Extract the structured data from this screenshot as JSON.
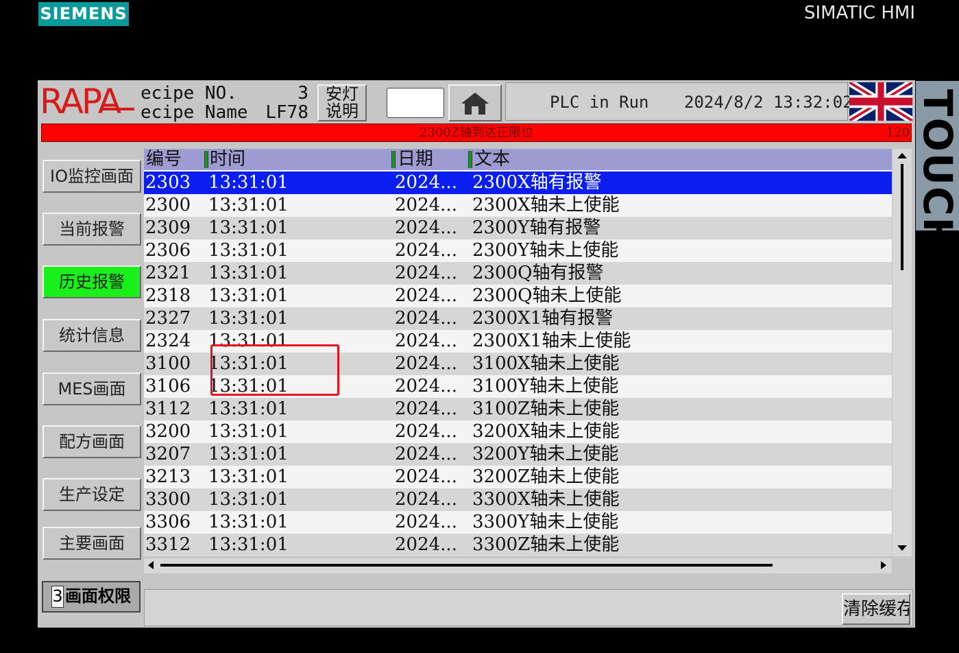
{
  "brand": {
    "logo_text": "SIEMENS",
    "product": "SIMATIC HMI",
    "side_label": "TOUCH"
  },
  "header": {
    "logo_text": "RAPA",
    "recipe_no_label": "ecipe NO.",
    "recipe_no_value": "3",
    "recipe_name_label": "ecipe Name",
    "recipe_name_value": "LF78",
    "andon_line1": "安灯",
    "andon_line2": "说明",
    "status_text": "PLC in Run",
    "datetime": "2024/8/2 13:32:02"
  },
  "alarm_bar": {
    "text": "2300Z轴到达正限位",
    "count": "120",
    "color": "#ff0000"
  },
  "sidebar": {
    "items": [
      {
        "label": "IO监控画面"
      },
      {
        "label": "当前报警"
      },
      {
        "label": "历史报警",
        "active": true
      },
      {
        "label": "统计信息"
      },
      {
        "label": "MES画面"
      },
      {
        "label": "配方画面"
      },
      {
        "label": "生产设定"
      },
      {
        "label": "主要画面"
      }
    ],
    "permission_level": "3",
    "permission_label": "画面权限"
  },
  "alarm_table": {
    "columns": [
      "编号",
      "时间",
      "日期",
      "文本"
    ],
    "rows": [
      {
        "no": "2303",
        "time": "13:31:01",
        "date": "2024...",
        "text": "2300X轴有报警",
        "selected": true
      },
      {
        "no": "2300",
        "time": "13:31:01",
        "date": "2024...",
        "text": "2300X轴未上使能"
      },
      {
        "no": "2309",
        "time": "13:31:01",
        "date": "2024...",
        "text": "2300Y轴有报警"
      },
      {
        "no": "2306",
        "time": "13:31:01",
        "date": "2024...",
        "text": "2300Y轴未上使能"
      },
      {
        "no": "2321",
        "time": "13:31:01",
        "date": "2024...",
        "text": "2300Q轴有报警"
      },
      {
        "no": "2318",
        "time": "13:31:01",
        "date": "2024...",
        "text": "2300Q轴未上使能"
      },
      {
        "no": "2327",
        "time": "13:31:01",
        "date": "2024...",
        "text": "2300X1轴有报警"
      },
      {
        "no": "2324",
        "time": "13:31:01",
        "date": "2024...",
        "text": "2300X1轴未上使能"
      },
      {
        "no": "3100",
        "time": "13:31:01",
        "date": "2024...",
        "text": "3100X轴未上使能"
      },
      {
        "no": "3106",
        "time": "13:31:01",
        "date": "2024...",
        "text": "3100Y轴未上使能"
      },
      {
        "no": "3112",
        "time": "13:31:01",
        "date": "2024...",
        "text": "3100Z轴未上使能"
      },
      {
        "no": "3200",
        "time": "13:31:01",
        "date": "2024...",
        "text": "3200X轴未上使能"
      },
      {
        "no": "3207",
        "time": "13:31:01",
        "date": "2024...",
        "text": "3200Y轴未上使能"
      },
      {
        "no": "3213",
        "time": "13:31:01",
        "date": "2024...",
        "text": "3200Z轴未上使能"
      },
      {
        "no": "3300",
        "time": "13:31:01",
        "date": "2024...",
        "text": "3300X轴未上使能"
      },
      {
        "no": "3306",
        "time": "13:31:01",
        "date": "2024...",
        "text": "3300Y轴未上使能"
      },
      {
        "no": "3312",
        "time": "13:31:01",
        "date": "2024...",
        "text": "3300Z轴未上使能"
      }
    ]
  },
  "footer": {
    "clear_button": "清除缓存"
  },
  "colors": {
    "selected_row": "#0a1ef0",
    "active_nav": "#19f019",
    "table_header": "#9c9cd2",
    "annotation": "#e8101a"
  }
}
